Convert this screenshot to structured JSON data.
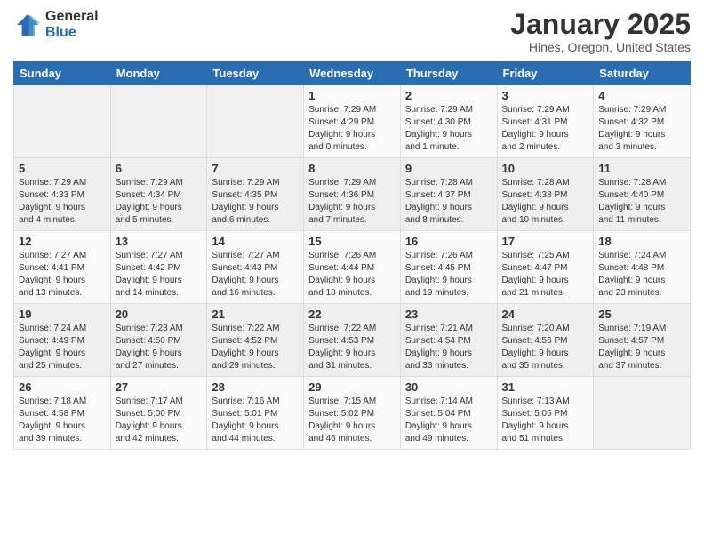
{
  "logo": {
    "general": "General",
    "blue": "Blue"
  },
  "title": "January 2025",
  "location": "Hines, Oregon, United States",
  "days_of_week": [
    "Sunday",
    "Monday",
    "Tuesday",
    "Wednesday",
    "Thursday",
    "Friday",
    "Saturday"
  ],
  "weeks": [
    [
      {
        "day": "",
        "info": ""
      },
      {
        "day": "",
        "info": ""
      },
      {
        "day": "",
        "info": ""
      },
      {
        "day": "1",
        "info": "Sunrise: 7:29 AM\nSunset: 4:29 PM\nDaylight: 9 hours\nand 0 minutes."
      },
      {
        "day": "2",
        "info": "Sunrise: 7:29 AM\nSunset: 4:30 PM\nDaylight: 9 hours\nand 1 minute."
      },
      {
        "day": "3",
        "info": "Sunrise: 7:29 AM\nSunset: 4:31 PM\nDaylight: 9 hours\nand 2 minutes."
      },
      {
        "day": "4",
        "info": "Sunrise: 7:29 AM\nSunset: 4:32 PM\nDaylight: 9 hours\nand 3 minutes."
      }
    ],
    [
      {
        "day": "5",
        "info": "Sunrise: 7:29 AM\nSunset: 4:33 PM\nDaylight: 9 hours\nand 4 minutes."
      },
      {
        "day": "6",
        "info": "Sunrise: 7:29 AM\nSunset: 4:34 PM\nDaylight: 9 hours\nand 5 minutes."
      },
      {
        "day": "7",
        "info": "Sunrise: 7:29 AM\nSunset: 4:35 PM\nDaylight: 9 hours\nand 6 minutes."
      },
      {
        "day": "8",
        "info": "Sunrise: 7:29 AM\nSunset: 4:36 PM\nDaylight: 9 hours\nand 7 minutes."
      },
      {
        "day": "9",
        "info": "Sunrise: 7:28 AM\nSunset: 4:37 PM\nDaylight: 9 hours\nand 8 minutes."
      },
      {
        "day": "10",
        "info": "Sunrise: 7:28 AM\nSunset: 4:38 PM\nDaylight: 9 hours\nand 10 minutes."
      },
      {
        "day": "11",
        "info": "Sunrise: 7:28 AM\nSunset: 4:40 PM\nDaylight: 9 hours\nand 11 minutes."
      }
    ],
    [
      {
        "day": "12",
        "info": "Sunrise: 7:27 AM\nSunset: 4:41 PM\nDaylight: 9 hours\nand 13 minutes."
      },
      {
        "day": "13",
        "info": "Sunrise: 7:27 AM\nSunset: 4:42 PM\nDaylight: 9 hours\nand 14 minutes."
      },
      {
        "day": "14",
        "info": "Sunrise: 7:27 AM\nSunset: 4:43 PM\nDaylight: 9 hours\nand 16 minutes."
      },
      {
        "day": "15",
        "info": "Sunrise: 7:26 AM\nSunset: 4:44 PM\nDaylight: 9 hours\nand 18 minutes."
      },
      {
        "day": "16",
        "info": "Sunrise: 7:26 AM\nSunset: 4:45 PM\nDaylight: 9 hours\nand 19 minutes."
      },
      {
        "day": "17",
        "info": "Sunrise: 7:25 AM\nSunset: 4:47 PM\nDaylight: 9 hours\nand 21 minutes."
      },
      {
        "day": "18",
        "info": "Sunrise: 7:24 AM\nSunset: 4:48 PM\nDaylight: 9 hours\nand 23 minutes."
      }
    ],
    [
      {
        "day": "19",
        "info": "Sunrise: 7:24 AM\nSunset: 4:49 PM\nDaylight: 9 hours\nand 25 minutes."
      },
      {
        "day": "20",
        "info": "Sunrise: 7:23 AM\nSunset: 4:50 PM\nDaylight: 9 hours\nand 27 minutes."
      },
      {
        "day": "21",
        "info": "Sunrise: 7:22 AM\nSunset: 4:52 PM\nDaylight: 9 hours\nand 29 minutes."
      },
      {
        "day": "22",
        "info": "Sunrise: 7:22 AM\nSunset: 4:53 PM\nDaylight: 9 hours\nand 31 minutes."
      },
      {
        "day": "23",
        "info": "Sunrise: 7:21 AM\nSunset: 4:54 PM\nDaylight: 9 hours\nand 33 minutes."
      },
      {
        "day": "24",
        "info": "Sunrise: 7:20 AM\nSunset: 4:56 PM\nDaylight: 9 hours\nand 35 minutes."
      },
      {
        "day": "25",
        "info": "Sunrise: 7:19 AM\nSunset: 4:57 PM\nDaylight: 9 hours\nand 37 minutes."
      }
    ],
    [
      {
        "day": "26",
        "info": "Sunrise: 7:18 AM\nSunset: 4:58 PM\nDaylight: 9 hours\nand 39 minutes."
      },
      {
        "day": "27",
        "info": "Sunrise: 7:17 AM\nSunset: 5:00 PM\nDaylight: 9 hours\nand 42 minutes."
      },
      {
        "day": "28",
        "info": "Sunrise: 7:16 AM\nSunset: 5:01 PM\nDaylight: 9 hours\nand 44 minutes."
      },
      {
        "day": "29",
        "info": "Sunrise: 7:15 AM\nSunset: 5:02 PM\nDaylight: 9 hours\nand 46 minutes."
      },
      {
        "day": "30",
        "info": "Sunrise: 7:14 AM\nSunset: 5:04 PM\nDaylight: 9 hours\nand 49 minutes."
      },
      {
        "day": "31",
        "info": "Sunrise: 7:13 AM\nSunset: 5:05 PM\nDaylight: 9 hours\nand 51 minutes."
      },
      {
        "day": "",
        "info": ""
      }
    ]
  ]
}
